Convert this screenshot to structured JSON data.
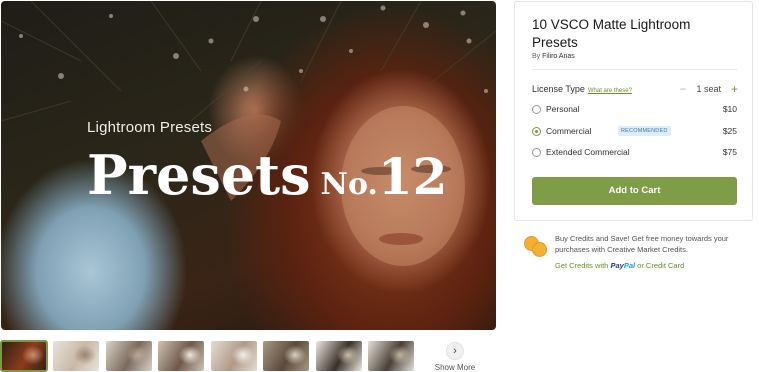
{
  "hero": {
    "kicker": "Lightroom Presets",
    "headline_word": "Presets",
    "headline_no": "No.",
    "headline_number": "12"
  },
  "thumbnails": [
    {
      "active": true,
      "colors": [
        "#2b2015",
        "#8b3b1c",
        "#c98e6c"
      ]
    },
    {
      "active": false,
      "colors": [
        "#e8e3dc",
        "#c9b8a6",
        "#9a8472"
      ]
    },
    {
      "active": false,
      "colors": [
        "#d9d2c8",
        "#7a6a5c",
        "#b8a898"
      ]
    },
    {
      "active": false,
      "colors": [
        "#cfc4b5",
        "#6e5848",
        "#efe8de"
      ]
    },
    {
      "active": false,
      "colors": [
        "#e4ddd4",
        "#b09a86",
        "#f3efe9"
      ]
    },
    {
      "active": false,
      "colors": [
        "#a89a86",
        "#5b4a3a",
        "#d8cfc2"
      ]
    },
    {
      "active": false,
      "colors": [
        "#eee9e2",
        "#3a3028",
        "#c8bca9"
      ]
    },
    {
      "active": false,
      "colors": [
        "#e6e0d8",
        "#4a3f36",
        "#bfb2a1"
      ]
    }
  ],
  "show_more": {
    "label": "Show More",
    "icon": "chevron-right-icon"
  },
  "product": {
    "title": "10 VSCO Matte Lightroom Presets",
    "by_label": "By",
    "author": "Filiro Anas",
    "license_label": "License Type",
    "license_help": "What are these?",
    "seat_label": "1 seat",
    "seat_minus": "−",
    "seat_plus": "+",
    "options": [
      {
        "name": "Personal",
        "price": "$10",
        "checked": false,
        "badge": ""
      },
      {
        "name": "Commercial",
        "price": "$25",
        "checked": true,
        "badge": "RECOMMENDED"
      },
      {
        "name": "Extended Commercial",
        "price": "$75",
        "checked": false,
        "badge": ""
      }
    ],
    "cart_button": "Add to Cart"
  },
  "promo": {
    "text": "Buy Credits and Save! Get free money towards your purchases with Creative Market Credits.",
    "credits_prefix": "Get Credits with",
    "paypal_pay": "Pay",
    "paypal_pal": "Pal",
    "credits_suffix": "or Credit Card"
  },
  "colors": {
    "accent": "#7f9c46",
    "link": "#6e8f2a",
    "badge_text": "#3b78b6",
    "badge_bg": "#dcecf8",
    "coin": "#f2b035"
  }
}
